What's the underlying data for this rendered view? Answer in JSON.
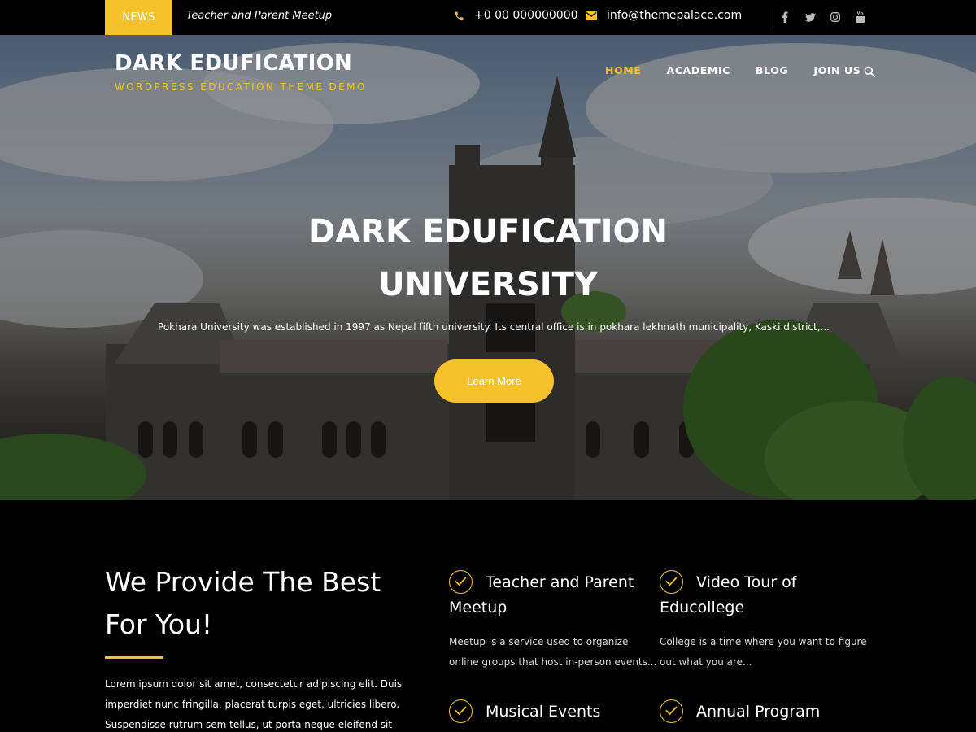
{
  "topbar": {
    "news_label": "NEWS",
    "news_text": "Teacher and Parent Meetup",
    "phone": "+0 00 000000000",
    "email": "info@themepalace.com",
    "social_icons": [
      "facebook-icon",
      "twitter-icon",
      "instagram-icon",
      "youtube-icon"
    ]
  },
  "brand": {
    "title": "DARK EDUFICATION",
    "tagline": "WORDPRESS EDUCATION THEME DEMO"
  },
  "nav": {
    "items": [
      "HOME",
      "ACADEMIC",
      "BLOG",
      "JOIN US"
    ],
    "active": "HOME"
  },
  "hero": {
    "title_line1": "DARK EDUFICATION",
    "title_line2": "UNIVERSITY",
    "description": "Pokhara University was established in 1997 as Nepal fifth university. Its central office is in pokhara lekhnath municipality, Kaski district,...",
    "button_label": "Learn More"
  },
  "intro": {
    "title_line1": "We Provide The Best",
    "title_line2": "For You!",
    "body_lines": [
      "Lorem ipsum dolor sit amet, consectetur adipiscing elit. Duis",
      "imperdiet nunc fringilla, placerat turpis eget, ultricies libero.",
      "Suspendisse rutrum sem tellus, ut porta neque eleifend sit amet."
    ]
  },
  "features": [
    {
      "title": "Teacher and Parent Meetup",
      "desc": "Meetup is a service used to organize online groups that host in-person events..."
    },
    {
      "title": "Video Tour of Educollege",
      "desc": "College is a time where you want to figure out what you are..."
    },
    {
      "title": "Musical Events",
      "desc": ""
    },
    {
      "title": "Annual Program",
      "desc": ""
    }
  ],
  "colors": {
    "accent": "#f6c22c",
    "background": "#000000",
    "text": "#ffffff"
  }
}
